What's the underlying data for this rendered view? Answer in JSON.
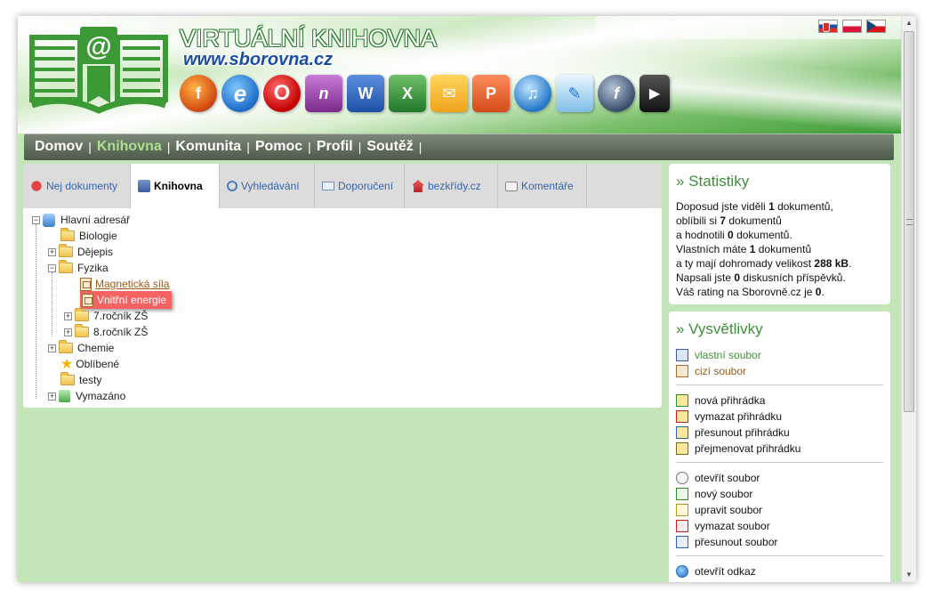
{
  "header": {
    "title": "VIRTUÁLNÍ KNIHOVNA",
    "url": "www.sborovna.cz",
    "app_icons": [
      "firefox-icon",
      "ie-icon",
      "opera-icon",
      "onenote-icon",
      "word-icon",
      "excel-icon",
      "outlook-icon",
      "powerpoint-icon",
      "media-icon",
      "publisher-icon",
      "flash-icon",
      "avi-icon"
    ],
    "languages": [
      "sk",
      "pl",
      "cz"
    ]
  },
  "nav": {
    "items": [
      {
        "label": "Domov",
        "active": false
      },
      {
        "label": "Knihovna",
        "active": true
      },
      {
        "label": "Komunita",
        "active": false
      },
      {
        "label": "Pomoc",
        "active": false
      },
      {
        "label": "Profil",
        "active": false
      },
      {
        "label": "Soutěž",
        "active": false
      }
    ],
    "separator": "|"
  },
  "tabs": [
    {
      "label": "Nej dokumenty"
    },
    {
      "label": "Knihovna",
      "active": true
    },
    {
      "label": "Vyhledávání"
    },
    {
      "label": "Doporučení"
    },
    {
      "label": "bezkřídy.cz"
    },
    {
      "label": "Komentáře"
    }
  ],
  "tree": {
    "root": "Hlavní adresář",
    "nodes": [
      {
        "label": "Biologie"
      },
      {
        "label": "Dějepis"
      },
      {
        "label": "Fyzika"
      },
      {
        "label": "Magnetická síla"
      },
      {
        "label": "Vnitřní energie"
      },
      {
        "label": "7.ročník ZŠ"
      },
      {
        "label": "8.ročník ZŠ"
      },
      {
        "label": "Chemie"
      },
      {
        "label": "Oblíbené"
      },
      {
        "label": "testy"
      },
      {
        "label": "Vymazáno"
      }
    ]
  },
  "stats": {
    "title": "» Statistiky",
    "lines": [
      [
        "Doposud jste viděli ",
        "1",
        " dokumentů,"
      ],
      [
        "oblíbili si ",
        "7",
        " dokumentů"
      ],
      [
        "a hodnotili ",
        "0",
        " dokumentů."
      ],
      [
        "Vlastních máte ",
        "1",
        " dokumentů"
      ],
      [
        "a ty mají dohromady velikost ",
        "288 kB",
        "."
      ],
      [
        "Napsali jste ",
        "0",
        " diskusních příspěvků."
      ],
      [
        "Váš rating na Sborovně.cz je ",
        "0",
        "."
      ]
    ]
  },
  "legend": {
    "title": "» Vysvětlivky",
    "files": [
      "vlastní soubor",
      "cizí soubor"
    ],
    "folders": [
      "nová přihrádka",
      "vymazat přihrádku",
      "přesunout přihrádku",
      "přejmenovat přihrádku"
    ],
    "file_actions": [
      "otevřít soubor",
      "nový soubor",
      "upravit soubor",
      "vymazat soubor",
      "přesunout soubor"
    ],
    "links": [
      "otevřít odkaz"
    ]
  }
}
